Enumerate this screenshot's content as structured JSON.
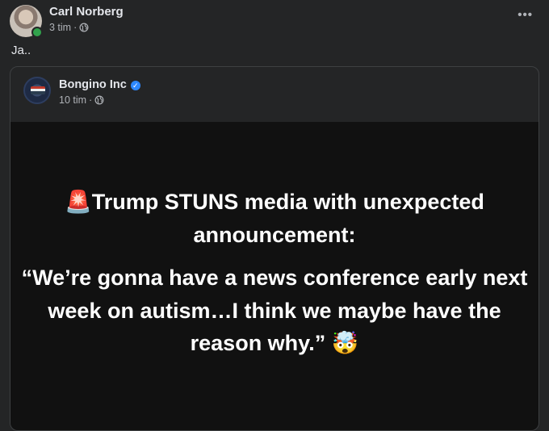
{
  "post": {
    "author_name": "Carl Norberg",
    "time": "3 tim",
    "separator": "·",
    "text": "Ja..",
    "more_label": "•••",
    "icons": {
      "avatar": "avatar",
      "privacy": "globe-icon",
      "more": "more-options-icon",
      "online": "online-status-dot"
    },
    "colors": {
      "online": "#31a24c"
    }
  },
  "shared": {
    "author_name": "Bongino Inc",
    "time": "10 tim",
    "separator": "·",
    "verified_glyph": "✓",
    "icons": {
      "verified": "verified-badge-icon",
      "privacy": "globe-icon"
    },
    "colors": {
      "verified": "#2d88ff"
    },
    "media": {
      "headline_emoji": "🚨",
      "headline": "Trump STUNS media with unexpected announcement:",
      "quote": "“We’re gonna have a news conference early next week on autism…I think we maybe have the reason why.”",
      "quote_emoji": "🤯"
    }
  }
}
